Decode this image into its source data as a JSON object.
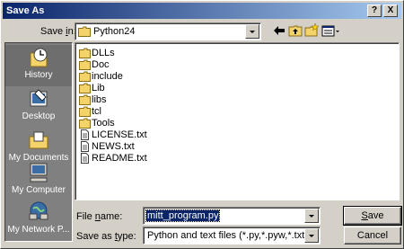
{
  "window": {
    "title": "Save As"
  },
  "titlebar_buttons": {
    "help": "?",
    "close": "X"
  },
  "top": {
    "save_in_label_pre": "Save ",
    "save_in_label_key": "i",
    "save_in_label_post": "n:",
    "save_in_value": "Python24"
  },
  "places": [
    {
      "label": "History",
      "icon": "history-icon"
    },
    {
      "label": "Desktop",
      "icon": "desktop-icon"
    },
    {
      "label": "My Documents",
      "icon": "my-documents-icon"
    },
    {
      "label": "My Computer",
      "icon": "my-computer-icon"
    },
    {
      "label": "My Network P...",
      "icon": "my-network-places-icon"
    }
  ],
  "files": [
    {
      "name": "DLLs",
      "type": "folder"
    },
    {
      "name": "Doc",
      "type": "folder"
    },
    {
      "name": "include",
      "type": "folder"
    },
    {
      "name": "Lib",
      "type": "folder"
    },
    {
      "name": "libs",
      "type": "folder"
    },
    {
      "name": "tcl",
      "type": "folder"
    },
    {
      "name": "Tools",
      "type": "folder"
    },
    {
      "name": "LICENSE.txt",
      "type": "text"
    },
    {
      "name": "NEWS.txt",
      "type": "text"
    },
    {
      "name": "README.txt",
      "type": "text"
    }
  ],
  "bottom": {
    "file_name_label_pre": "File ",
    "file_name_label_key": "n",
    "file_name_label_post": "ame:",
    "file_name_value": "mitt_program.py",
    "save_type_label_pre": "Save as ",
    "save_type_label_key": "t",
    "save_type_label_post": "ype:",
    "save_type_value": "Python and text files (*.py,*.pyw,*.txt)"
  },
  "buttons": {
    "save_key": "S",
    "save_rest": "ave",
    "cancel": "Cancel"
  }
}
